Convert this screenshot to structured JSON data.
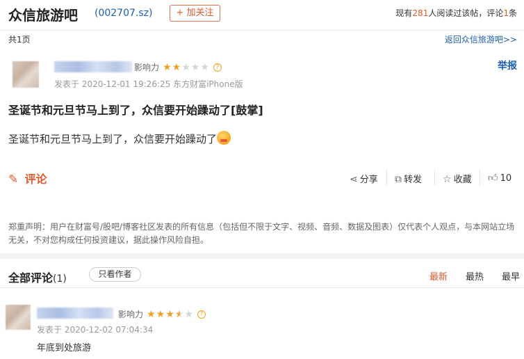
{
  "header": {
    "forum_name": "众信旅游吧",
    "stock_code": "(002707.sz)",
    "follow_label": "+ 加关注",
    "read_prefix": "现有",
    "read_count": "281",
    "read_mid": "人阅读过该帖，评论",
    "comment_count": "1",
    "read_suffix": "条"
  },
  "pager": {
    "page_count": "共1页",
    "back_link": "返回众信旅游吧>>"
  },
  "post": {
    "influence_label": "影响力",
    "rating": 2,
    "rating_max": 5,
    "meta": "发表于 2020-12-01 19:26:25 东方财富iPhone版",
    "report_label": "举报",
    "title": "圣诞节和元旦节马上到了，众信要开始躁动了[鼓掌]",
    "body": "圣诞节和元旦节马上到了，众信要开始躁动了"
  },
  "actions": {
    "comment_label": "评论",
    "share_label": "分享",
    "repost_label": "转发",
    "collect_label": "收藏",
    "like_count": "10"
  },
  "disclaimer": "郑重声明：用户在财富号/股吧/博客社区发表的所有信息（包括但不限于文字、视频、音频、数据及图表）仅代表个人观点，与本网站立场无关，不对您构成任何投资建议，据此操作风险自担。",
  "comments_section": {
    "title": "全部评论",
    "count": "(1)",
    "author_only_label": "只看作者",
    "sort_latest": "最新",
    "sort_hot": "最热",
    "sort_earliest": "最早"
  },
  "comments": [
    {
      "influence_label": "影响力",
      "rating": 3.5,
      "rating_max": 5,
      "time": "发表于 2020-12-02 07:04:34",
      "text": "年底到处旅游"
    }
  ],
  "colors": {
    "accent": "#e05a2b",
    "link": "#1a5fb4",
    "star": "#f0a020"
  }
}
